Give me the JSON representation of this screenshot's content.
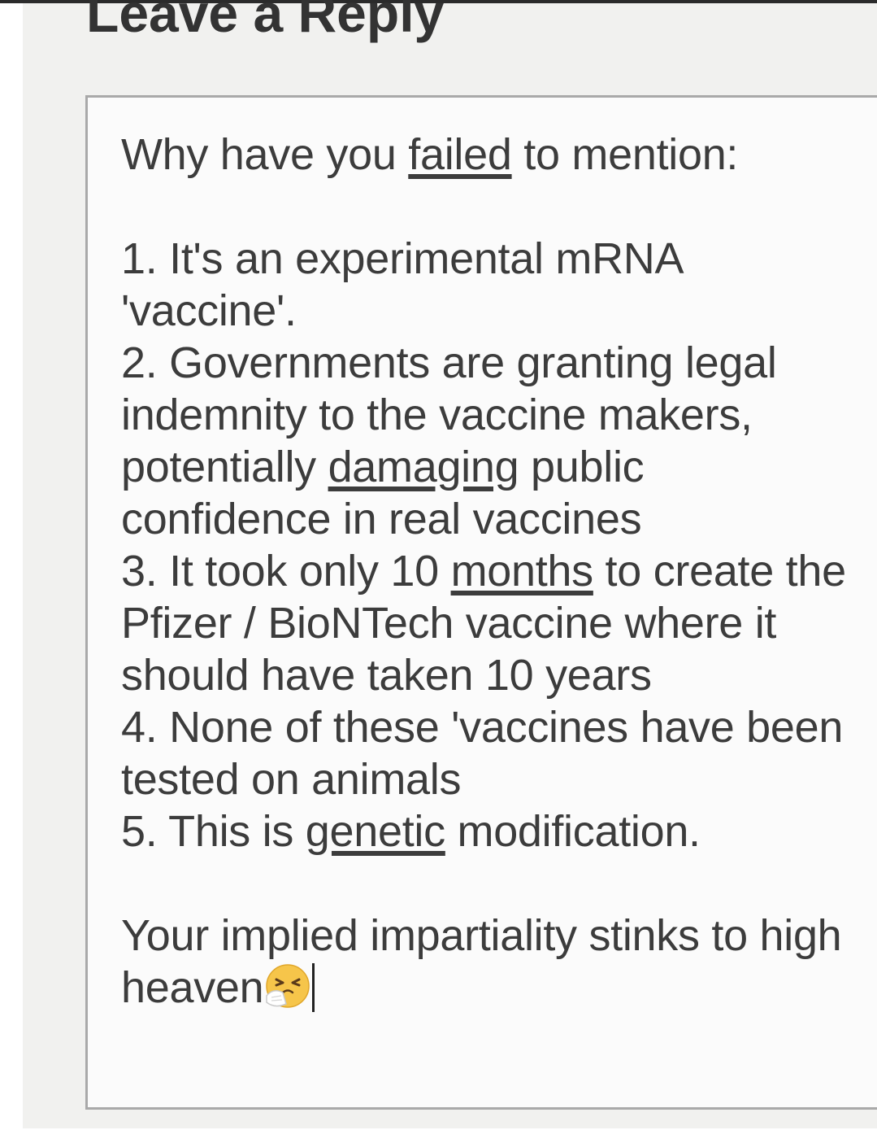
{
  "form": {
    "heading": "Leave a Reply",
    "comment": {
      "line1": {
        "before": "Why have you ",
        "flagged": "failed",
        "after": " to mention:"
      },
      "line2": "1. It's an experimental mRNA",
      "line3": "'vaccine'.",
      "line4": "2. Governments are granting legal",
      "line5": "indemnity to the vaccine makers,",
      "line6": {
        "before": "potentially ",
        "flagged": "damaging",
        "after": " public"
      },
      "line7": "confidence in real vaccines",
      "line8": {
        "before": "3. It took only 10 ",
        "flagged": "months",
        "after": " to create the"
      },
      "line9": "Pfizer / BioNTech vaccine where it",
      "line10": "should have taken 10 years",
      "line11": "4. None of these 'vaccines have been",
      "line12": "tested on animals",
      "line13": {
        "before": "5. This is ",
        "flagged": "genetic",
        "after": " modification."
      },
      "line14": "Your implied impartiality stinks to high",
      "line15": "heaven",
      "emoji": "sneezing-face-icon"
    }
  }
}
